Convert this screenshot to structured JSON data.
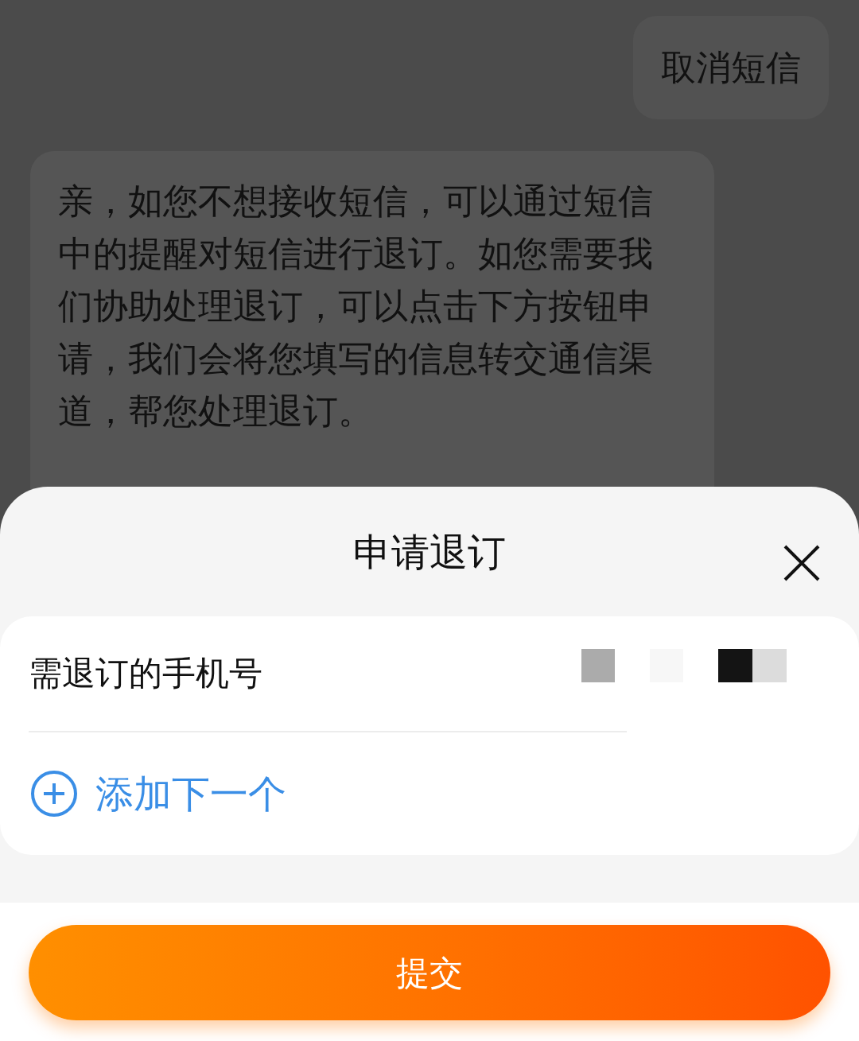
{
  "chat": {
    "messages": [
      {
        "kind": "outgoing",
        "text": "取消短信"
      },
      {
        "kind": "incoming",
        "text": "亲，如您不想接收短信，可以通过短信中的提醒对短信进行退订。如您需要我们协助处理退订，可以点击下方按钮申请，我们会将您填写的信息转交通信渠道，帮您处理退订。"
      }
    ]
  },
  "sheet": {
    "title": "申请退订",
    "fields": [
      {
        "label": "需退订的手机号"
      }
    ],
    "add_link": "添加下一个",
    "submit": "提交"
  }
}
